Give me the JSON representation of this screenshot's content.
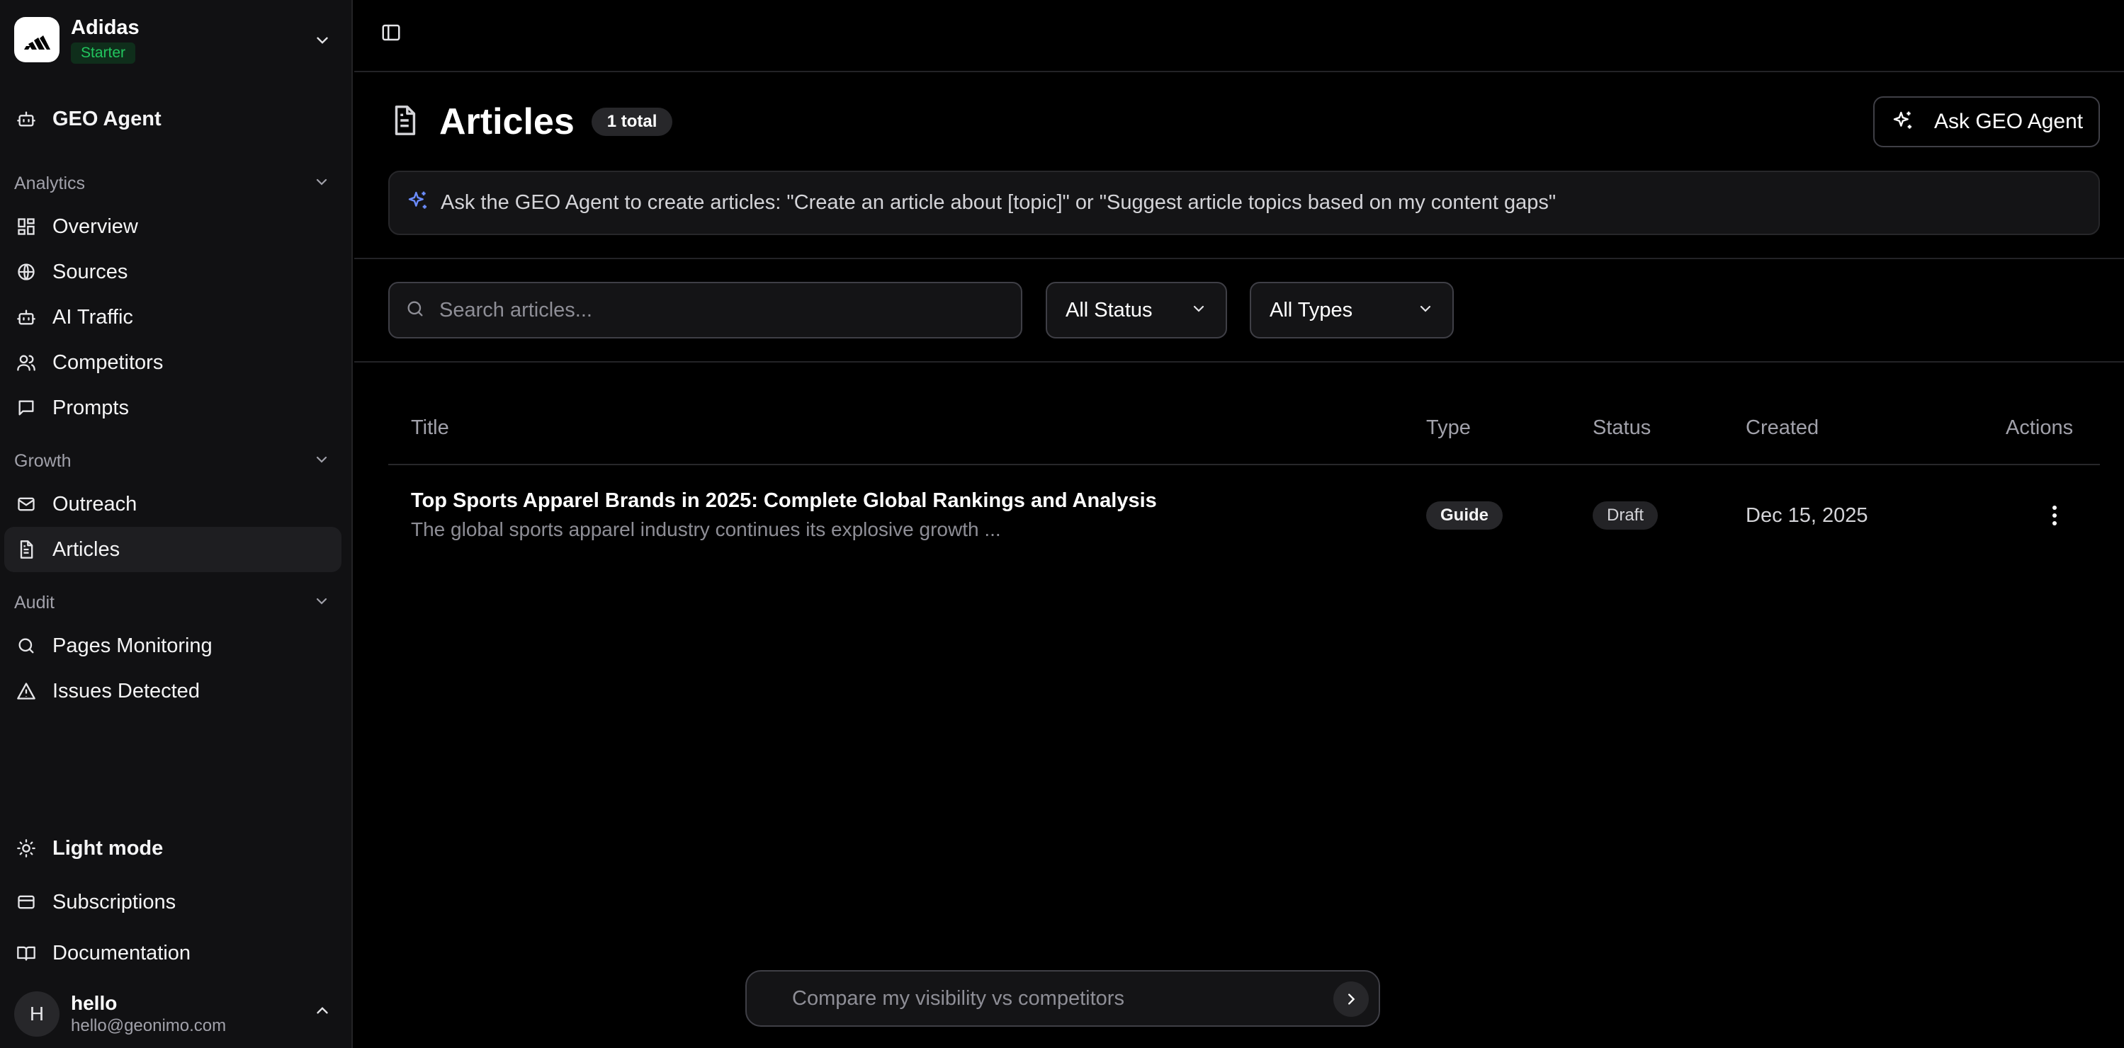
{
  "brand": {
    "name": "Adidas",
    "plan": "Starter"
  },
  "nav": {
    "agent": "GEO Agent",
    "analytics": {
      "heading": "Analytics",
      "items": [
        "Overview",
        "Sources",
        "AI Traffic",
        "Competitors",
        "Prompts"
      ]
    },
    "growth": {
      "heading": "Growth",
      "items": [
        "Outreach",
        "Articles"
      ]
    },
    "audit": {
      "heading": "Audit",
      "items": [
        "Pages Monitoring",
        "Issues Detected"
      ]
    },
    "bottom": [
      "Light mode",
      "Subscriptions",
      "Documentation"
    ]
  },
  "user": {
    "initial": "H",
    "name": "hello",
    "email": "hello@geonimo.com"
  },
  "page": {
    "title": "Articles",
    "total_badge": "1 total",
    "ask_button": "Ask GEO Agent",
    "hint": "Ask the GEO Agent to create articles: \"Create an article about [topic]\" or \"Suggest article topics based on my content gaps\""
  },
  "filters": {
    "search_placeholder": "Search articles...",
    "status": "All Status",
    "type": "All Types"
  },
  "table": {
    "columns": [
      "Title",
      "Type",
      "Status",
      "Created",
      "Actions"
    ],
    "rows": [
      {
        "title": "Top Sports Apparel Brands in 2025: Complete Global Rankings and Analysis",
        "description": "The global sports apparel industry continues its explosive growth ...",
        "type": "Guide",
        "status": "Draft",
        "created": "Dec 15, 2025"
      }
    ]
  },
  "composer": {
    "placeholder": "Compare my visibility vs competitors"
  },
  "colors": {
    "accent": "#22c55e",
    "sparkle": "#6b8cff",
    "background": "#000000",
    "sidebar": "#111113"
  }
}
